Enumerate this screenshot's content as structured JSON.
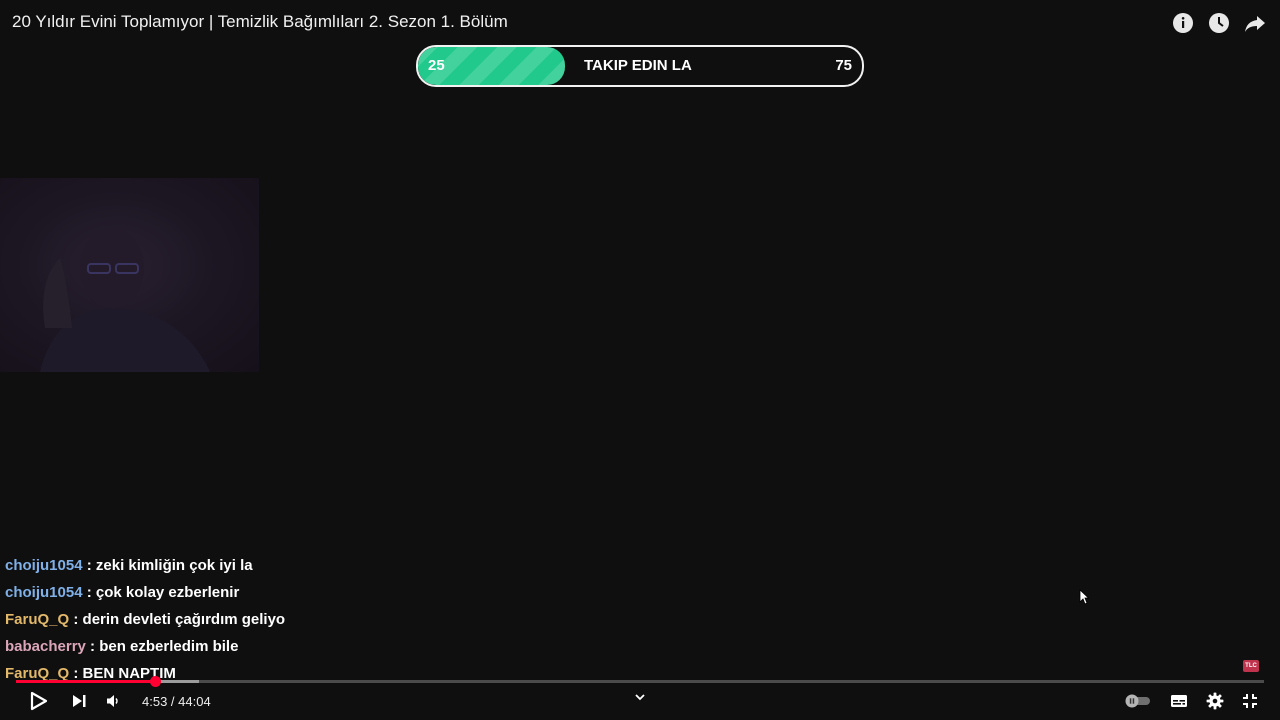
{
  "video": {
    "title": "20 Yıldır Evini Toplamıyor | Temizlik Bağımlıları 2. Sezon 1. Bölüm"
  },
  "top_icons": [
    "info-icon",
    "watch-later-clock-icon",
    "share-arrow-icon"
  ],
  "goal": {
    "start": "25",
    "label": "TAKIP EDIN LA",
    "end": "75",
    "progress_fraction": 0.33,
    "fill_color": "#22c98d"
  },
  "chat": [
    {
      "user": "choiju1054",
      "sep": " : ",
      "message": "zeki kimliğin çok iyi la",
      "color": "blue"
    },
    {
      "user": "choiju1054",
      "sep": " : ",
      "message": "çok kolay ezberlenir",
      "color": "blue"
    },
    {
      "user": "FaruQ_Q",
      "sep": " : ",
      "message": "derin devleti çağırdım geliyo",
      "color": "orange"
    },
    {
      "user": "babacherry",
      "sep": " : ",
      "message": "ben ezberledim bile",
      "color": "pink"
    },
    {
      "user": "FaruQ_Q",
      "sep": " : ",
      "message": "BEN NAPTIM",
      "color": "orange"
    }
  ],
  "player": {
    "current_time": "4:53",
    "separator": " / ",
    "duration": "44:04",
    "played_fraction": 0.111,
    "buffered_fraction": 0.147,
    "accent": "#ff0033"
  },
  "brand_mark": "TLC"
}
